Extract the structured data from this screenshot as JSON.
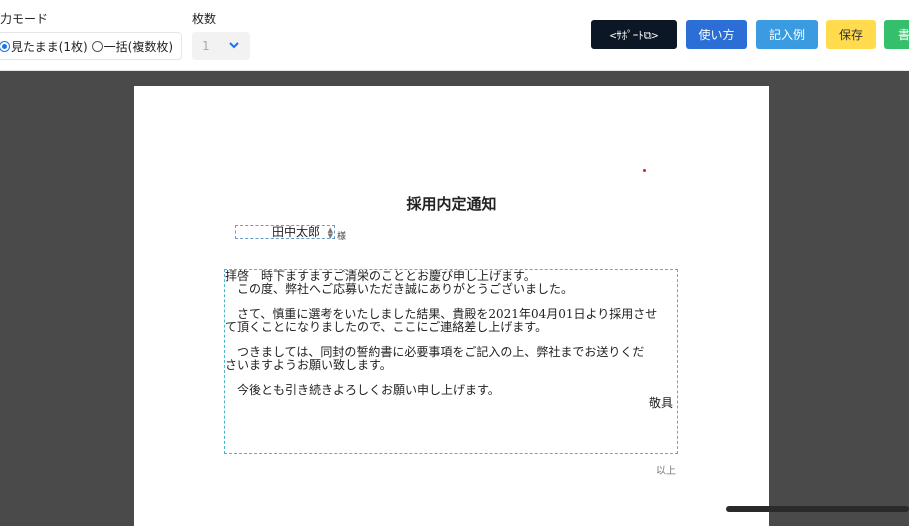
{
  "toolbar": {
    "mode_label": "力モード",
    "mode_options": [
      "見たまま(1枚)",
      "一括(複数枚)"
    ],
    "count_label": "枚数",
    "count_value": "1",
    "support_label": "<ｻﾎﾟｰﾄ⧉>",
    "howto_label": "使い方",
    "example_label": "記入例",
    "save_label": "保存",
    "write_label": "書"
  },
  "document": {
    "title": "採用内定通知",
    "recipient_name": "田中太郎",
    "honorific": "様",
    "body_lines": [
      "拝啓　時下ますますご清栄のこととお慶び申し上げます。",
      "　この度、弊社へご応募いただき誠にありがとうございました。",
      "",
      "　さて、慎重に選考をいたしました結果、貴殿を2021年04月01日より採用させ",
      "て頂くことになりましたので、ここにご連絡差し上げます。",
      "",
      "　つきましては、同封の誓約書に必要事項をご記入の上、弊社までお送りくだ",
      "さいますようお願い致します。",
      "",
      "　今後とも引き続きよろしくお願い申し上げます。"
    ],
    "closing": "敬具",
    "end_note": "以上"
  },
  "colors": {
    "support": "#0b1725",
    "howto": "#2b6fd6",
    "example": "#3a9be0",
    "save": "#ffdb4d",
    "write": "#34c06a"
  }
}
